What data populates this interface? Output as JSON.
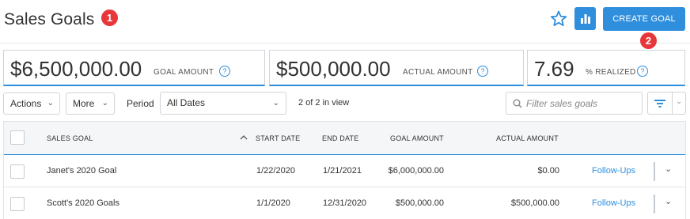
{
  "header": {
    "title": "Sales Goals",
    "callout_1": "1",
    "callout_2": "2",
    "create_label": "CREATE GOAL"
  },
  "stats": [
    {
      "value": "$6,500,000.00",
      "label": "GOAL AMOUNT",
      "help": "?"
    },
    {
      "value": "$500,000.00",
      "label": "ACTUAL AMOUNT",
      "help": "?"
    },
    {
      "value": "7.69",
      "label": "% REALIZED",
      "help": "?"
    }
  ],
  "toolbar": {
    "actions_label": "Actions",
    "more_label": "More",
    "period_label": "Period",
    "period_value": "All Dates",
    "count_text": "2 of 2 in view",
    "search_placeholder": "Filter sales goals"
  },
  "table": {
    "columns": [
      "SALES GOAL",
      "START DATE",
      "END DATE",
      "GOAL AMOUNT",
      "ACTUAL AMOUNT"
    ],
    "rows": [
      {
        "name": "Janet's 2020 Goal",
        "start": "1/22/2020",
        "end": "1/21/2021",
        "goal": "$6,000,000.00",
        "actual": "$0.00",
        "link": "Follow-Ups"
      },
      {
        "name": "Scott's 2020 Goals",
        "start": "1/1/2020",
        "end": "12/31/2020",
        "goal": "$500,000.00",
        "actual": "$500,000.00",
        "link": "Follow-Ups"
      }
    ]
  },
  "colors": {
    "accent": "#2f8fdd",
    "callout": "#e8373b"
  },
  "icons": [
    "star-icon",
    "bar-chart-icon",
    "help-icon",
    "chevron-down-icon",
    "search-icon",
    "filter-icon",
    "sort-up-icon"
  ]
}
